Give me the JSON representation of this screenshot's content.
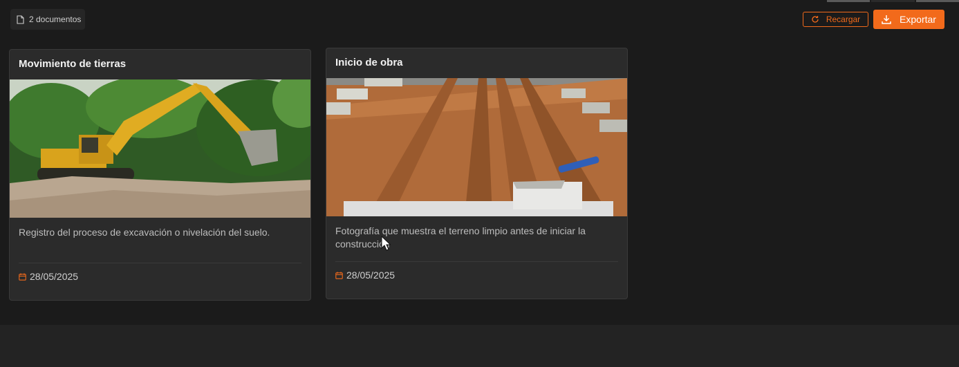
{
  "toolbar": {
    "doc_count": "2 documentos",
    "reload_label": "Recargar",
    "export_label": "Exportar",
    "accent_color": "#f26a1b"
  },
  "cards": [
    {
      "title": "Movimiento de tierras",
      "description": "Registro del proceso de excavación o nivelación del suelo.",
      "date": "28/05/2025",
      "image": "excavator-photo"
    },
    {
      "title": "Inicio de obra",
      "description": "Fotografía que muestra el terreno limpio antes de iniciar la construcción",
      "date": "28/05/2025",
      "image": "cleared-terrain-photo"
    }
  ],
  "icons": {
    "doc": "document-icon",
    "reload": "refresh-icon",
    "export": "download-icon",
    "date": "calendar-icon"
  }
}
